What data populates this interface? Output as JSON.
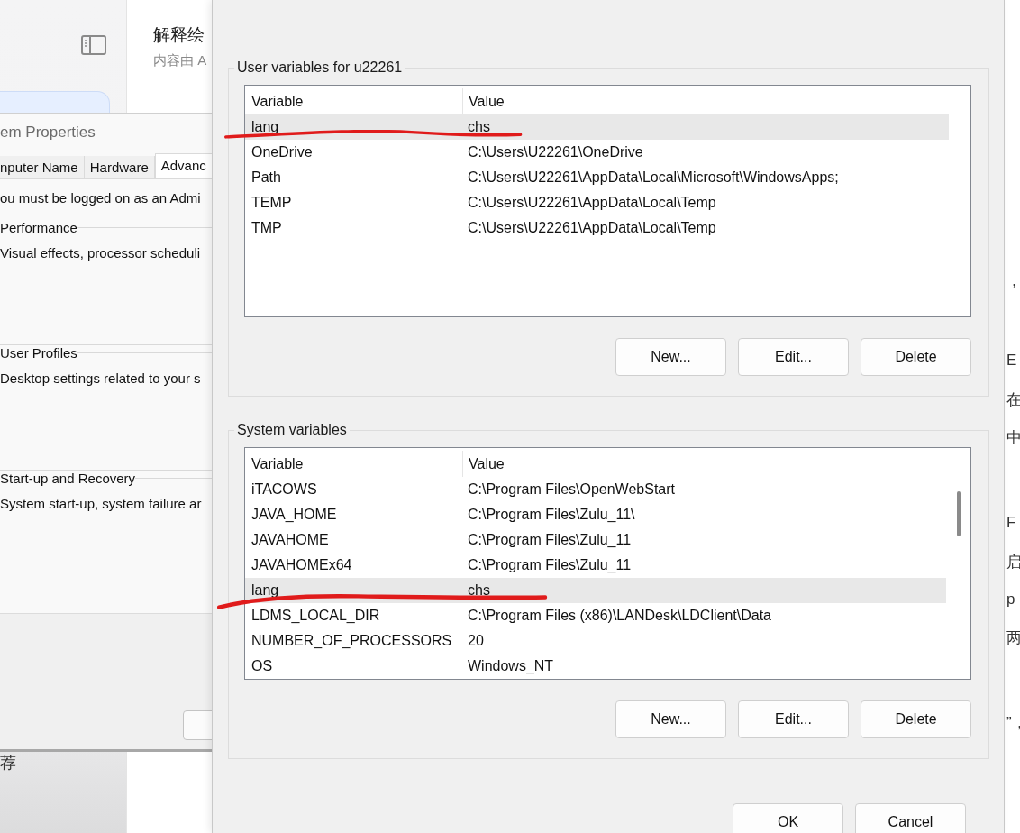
{
  "background_page": {
    "header_title": "解释绘",
    "header_subtitle": "内容由 A",
    "footer_text": "荐",
    "edge_texts": [
      "，",
      "E",
      "在",
      "中",
      "F",
      "启",
      "p",
      "两",
      "”，"
    ]
  },
  "system_properties": {
    "title": "em Properties",
    "tabs": [
      {
        "label": "nputer Name",
        "selected": false
      },
      {
        "label": "Hardware",
        "selected": false
      },
      {
        "label": "Advanc",
        "selected": true
      }
    ],
    "notice": "ou must be logged on as an Admi",
    "groups": [
      {
        "label": "Performance",
        "description": "Visual effects, processor scheduli"
      },
      {
        "label": "User Profiles",
        "description": "Desktop settings related to your s"
      },
      {
        "label": "Start-up and Recovery",
        "description": "System start-up, system failure ar"
      }
    ]
  },
  "environment_dialog": {
    "user_variables": {
      "label": "User variables for u22261",
      "columns": [
        "Variable",
        "Value"
      ],
      "rows": [
        {
          "variable": "lang",
          "value": "chs",
          "selected": true,
          "underlined": true
        },
        {
          "variable": "OneDrive",
          "value": "C:\\Users\\U22261\\OneDrive",
          "selected": false,
          "underlined": false
        },
        {
          "variable": "Path",
          "value": "C:\\Users\\U22261\\AppData\\Local\\Microsoft\\WindowsApps;",
          "selected": false,
          "underlined": false
        },
        {
          "variable": "TEMP",
          "value": "C:\\Users\\U22261\\AppData\\Local\\Temp",
          "selected": false,
          "underlined": false
        },
        {
          "variable": "TMP",
          "value": "C:\\Users\\U22261\\AppData\\Local\\Temp",
          "selected": false,
          "underlined": false
        }
      ],
      "buttons": [
        "New...",
        "Edit...",
        "Delete"
      ]
    },
    "system_variables": {
      "label": "System variables",
      "columns": [
        "Variable",
        "Value"
      ],
      "rows": [
        {
          "variable": "iTACOWS",
          "value": "C:\\Program Files\\OpenWebStart",
          "selected": false,
          "underlined": false
        },
        {
          "variable": "JAVA_HOME",
          "value": "C:\\Program Files\\Zulu_11\\",
          "selected": false,
          "underlined": false
        },
        {
          "variable": "JAVAHOME",
          "value": "C:\\Program Files\\Zulu_11",
          "selected": false,
          "underlined": false
        },
        {
          "variable": "JAVAHOMEx64",
          "value": "C:\\Program Files\\Zulu_11",
          "selected": false,
          "underlined": false
        },
        {
          "variable": "lang",
          "value": "chs",
          "selected": true,
          "underlined": true
        },
        {
          "variable": "LDMS_LOCAL_DIR",
          "value": "C:\\Program Files (x86)\\LANDesk\\LDClient\\Data",
          "selected": false,
          "underlined": false
        },
        {
          "variable": "NUMBER_OF_PROCESSORS",
          "value": "20",
          "selected": false,
          "underlined": false
        },
        {
          "variable": "OS",
          "value": "Windows_NT",
          "selected": false,
          "underlined": false
        }
      ],
      "buttons": [
        "New...",
        "Edit...",
        "Delete"
      ]
    },
    "buttons": [
      "OK",
      "Cancel"
    ]
  }
}
